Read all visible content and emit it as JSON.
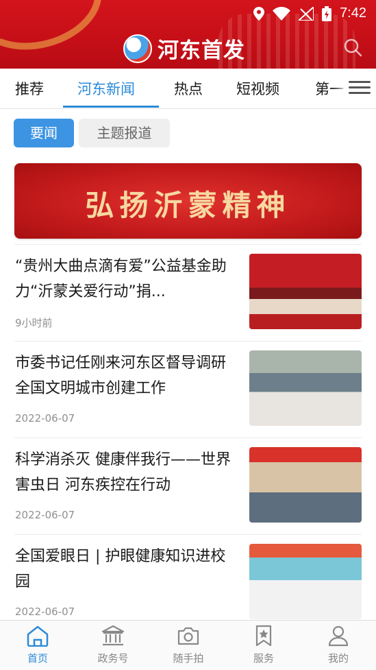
{
  "status_bar": {
    "time": "7:42"
  },
  "header": {
    "app_name": "河东首发"
  },
  "tabs": [
    {
      "label": "推荐"
    },
    {
      "label": "河东新闻"
    },
    {
      "label": "热点"
    },
    {
      "label": "短视频"
    },
    {
      "label": "第一"
    }
  ],
  "active_tab": "河东新闻",
  "sub_tabs": [
    {
      "label": "要闻"
    },
    {
      "label": "主题报道"
    }
  ],
  "banner": {
    "text": "弘扬沂蒙精神"
  },
  "news": [
    {
      "title": "“贵州大曲点滴有爱”公益基金助力“沂蒙关爱行动”捐...",
      "time": "9小时前"
    },
    {
      "title": "市委书记任刚来河东区督导调研全国文明城市创建工作",
      "time": "2022-06-07"
    },
    {
      "title": "科学消杀灭 健康伴我行——世界害虫日 河东疾控在行动",
      "time": "2022-06-07"
    },
    {
      "title": "全国爱眼日 | 护眼健康知识进校园",
      "time": "2022-06-07"
    }
  ],
  "bottom_nav": [
    {
      "label": "首页",
      "icon": "home-icon"
    },
    {
      "label": "政务号",
      "icon": "government-building-icon"
    },
    {
      "label": "随手拍",
      "icon": "camera-icon"
    },
    {
      "label": "服务",
      "icon": "bookmark-star-icon"
    },
    {
      "label": "我的",
      "icon": "person-icon"
    }
  ],
  "colors": {
    "brand_red": "#c70f18",
    "accent_blue": "#2a8ad8"
  }
}
